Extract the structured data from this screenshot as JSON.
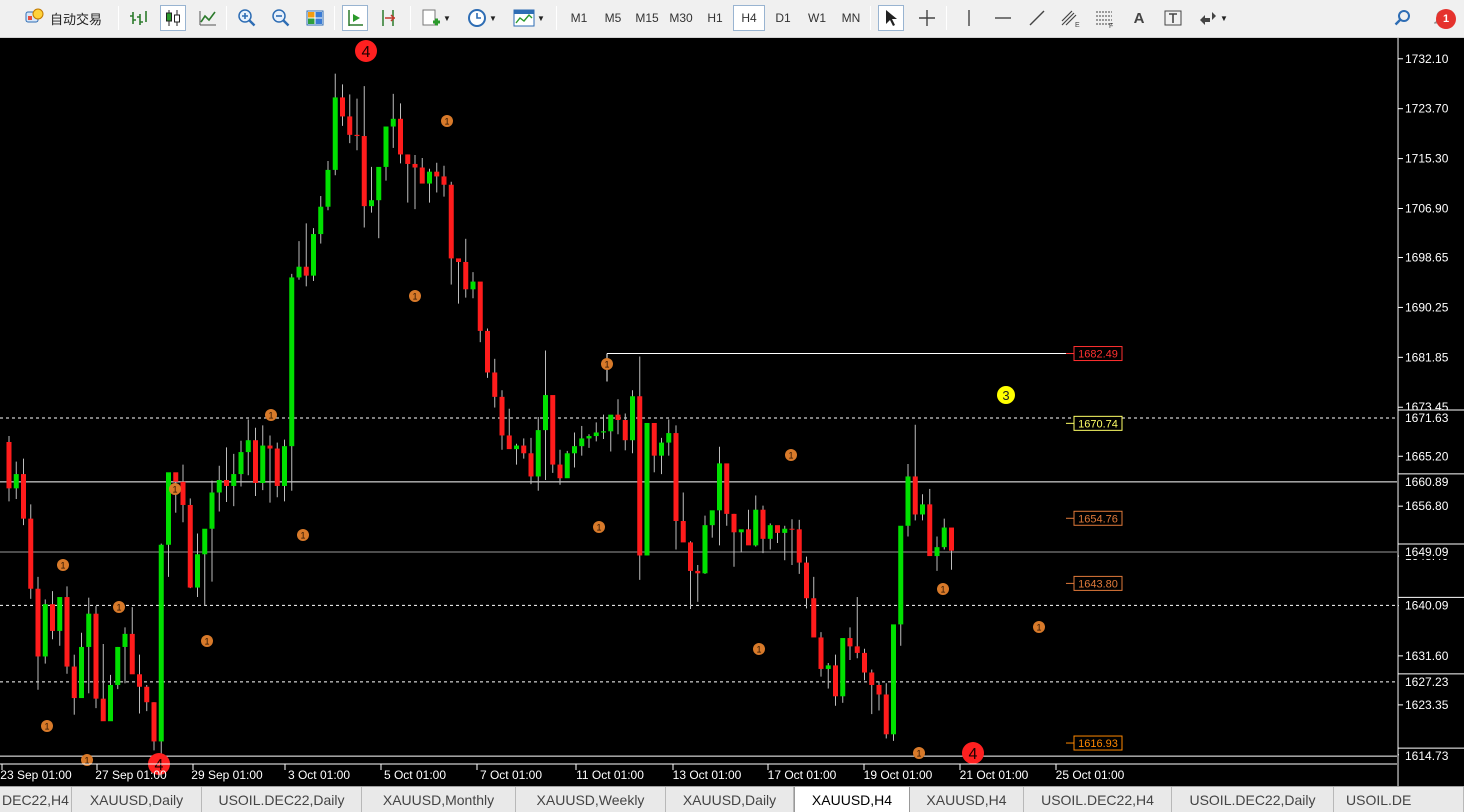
{
  "toolbar": {
    "autotrade_label": "自动交易",
    "timeframes": [
      "M1",
      "M5",
      "M15",
      "M30",
      "H1",
      "H4",
      "D1",
      "W1",
      "MN"
    ],
    "active_timeframe": "H4",
    "notifications_count": "1",
    "text_tool_label": "A",
    "equidistant_suffix": "E",
    "fib_suffix": "F",
    "icons": [
      "autotrade-icon",
      "bar-chart-icon",
      "candlestick-icon",
      "line-chart-icon",
      "zoom-in-icon",
      "zoom-out-icon",
      "tile-windows-icon",
      "auto-scroll-icon",
      "chart-shift-icon",
      "new-order-icon",
      "periods-icon",
      "templates-icon",
      "cursor-icon",
      "crosshair-icon",
      "vertical-line-icon",
      "horizontal-line-icon",
      "trendline-icon",
      "equidistant-channel-icon",
      "fibonacci-icon",
      "text-icon",
      "text-label-icon",
      "arrows-icon",
      "search-icon",
      "notifications-icon"
    ]
  },
  "chart": {
    "symbol": "XAUUSD",
    "timeframe": "H4",
    "colors": {
      "background": "#000000",
      "bull": "#00e000",
      "bear": "#ff1c1c",
      "wick": "#bdbdbd",
      "grid_line": "#ffffff",
      "wave_minor": "#d87a2a",
      "wave_major": "#ff2020",
      "wave_3": "#ffff00"
    },
    "price_axis": [
      "1732.10",
      "1723.70",
      "1715.30",
      "1706.90",
      "1698.65",
      "1690.25",
      "1681.85",
      "1673.45",
      "1665.20",
      "1656.80",
      "1648.40",
      "1640.05",
      "1631.60",
      "1623.35",
      "1614.95"
    ],
    "price_axis_highlights": [
      {
        "value": "1671.63",
        "style": "dashed"
      },
      {
        "value": "1660.89",
        "style": "solid"
      },
      {
        "value": "1649.09",
        "style": "solid-gray"
      },
      {
        "value": "1640.09",
        "style": "dashed"
      },
      {
        "value": "1627.23",
        "style": "dashed"
      },
      {
        "value": "1614.73",
        "style": "solid"
      }
    ],
    "time_axis": [
      "23 Sep 01:00",
      "27 Sep 01:00",
      "29 Sep 01:00",
      "3 Oct 01:00",
      "5 Oct 01:00",
      "7 Oct 01:00",
      "11 Oct 01:00",
      "13 Oct 01:00",
      "17 Oct 01:00",
      "19 Oct 01:00",
      "21 Oct 01:00",
      "25 Oct 01:00"
    ],
    "level_labels": [
      {
        "value": "1682.49",
        "color": "#ff3030",
        "border": "#ff3030"
      },
      {
        "value": "1670.74",
        "color": "#ffff66",
        "border": "#ffff66"
      },
      {
        "value": "1654.76",
        "color": "#e07a3a",
        "border": "#e07a3a"
      },
      {
        "value": "1643.80",
        "color": "#e07a3a",
        "border": "#e07a3a"
      },
      {
        "value": "1616.93",
        "color": "#ff8800",
        "border": "#ff8800"
      }
    ],
    "wave_markers": [
      {
        "label": "4",
        "kind": "major"
      },
      {
        "label": "1",
        "kind": "minor"
      },
      {
        "label": "3",
        "kind": "wave3"
      }
    ]
  },
  "chart_data": {
    "type": "candlestick",
    "title": "",
    "xlabel": "",
    "ylabel": "",
    "ylim": [
      1613.4,
      1735.6
    ],
    "x_ticks": [
      "23 Sep 01:00",
      "27 Sep 01:00",
      "29 Sep 01:00",
      "3 Oct 01:00",
      "5 Oct 01:00",
      "7 Oct 01:00",
      "11 Oct 01:00",
      "13 Oct 01:00",
      "17 Oct 01:00",
      "19 Oct 01:00",
      "21 Oct 01:00",
      "25 Oct 01:00"
    ],
    "ohlc": [
      [
        1667.6,
        1668.6,
        1657.6,
        1659.8
      ],
      [
        1659.8,
        1664.3,
        1658.0,
        1662.2
      ],
      [
        1662.2,
        1664.8,
        1653.6,
        1654.7
      ],
      [
        1654.7,
        1657.1,
        1641.2,
        1642.9
      ],
      [
        1642.9,
        1644.9,
        1625.9,
        1631.5
      ],
      [
        1631.5,
        1641.1,
        1630.3,
        1640.3
      ],
      [
        1640.3,
        1642.5,
        1634.4,
        1635.8
      ],
      [
        1635.8,
        1640.2,
        1633.3,
        1641.5
      ],
      [
        1641.5,
        1643.3,
        1628.6,
        1629.8
      ],
      [
        1629.8,
        1631.8,
        1621.7,
        1624.5
      ],
      [
        1624.5,
        1635.5,
        1625.9,
        1633.1
      ],
      [
        1633.1,
        1641.4,
        1625.3,
        1638.7
      ],
      [
        1638.7,
        1640.0,
        1622.8,
        1624.4
      ],
      [
        1624.4,
        1633.6,
        1621.6,
        1620.6
      ],
      [
        1620.6,
        1628.4,
        1622.0,
        1626.7
      ],
      [
        1626.7,
        1633.1,
        1626.0,
        1633.1
      ],
      [
        1633.1,
        1636.4,
        1627.0,
        1635.3
      ],
      [
        1635.3,
        1639.8,
        1628.9,
        1628.5
      ],
      [
        1628.5,
        1631.8,
        1621.9,
        1626.4
      ],
      [
        1626.4,
        1626.7,
        1622.3,
        1623.8
      ],
      [
        1623.8,
        1623.8,
        1615.7,
        1617.2
      ],
      [
        1617.2,
        1650.5,
        1614.5,
        1650.3
      ],
      [
        1650.3,
        1659.2,
        1644.9,
        1662.5
      ],
      [
        1662.5,
        1660.9,
        1655.7,
        1660.9
      ],
      [
        1660.9,
        1663.8,
        1654.1,
        1657.0
      ],
      [
        1657.0,
        1658.1,
        1643.0,
        1643.1
      ],
      [
        1643.1,
        1652.2,
        1641.5,
        1648.7
      ],
      [
        1648.7,
        1651.5,
        1640.1,
        1653.0
      ],
      [
        1653.0,
        1661.1,
        1644.1,
        1659.1
      ],
      [
        1659.1,
        1663.6,
        1655.9,
        1661.2
      ],
      [
        1661.2,
        1666.7,
        1657.5,
        1660.2
      ],
      [
        1660.2,
        1665.6,
        1656.8,
        1662.2
      ],
      [
        1662.2,
        1667.8,
        1660.1,
        1665.9
      ],
      [
        1665.9,
        1671.4,
        1662.0,
        1667.9
      ],
      [
        1667.9,
        1670.0,
        1658.5,
        1660.7
      ],
      [
        1660.7,
        1670.4,
        1659.5,
        1667.0
      ],
      [
        1667.0,
        1668.7,
        1657.4,
        1666.5
      ],
      [
        1666.5,
        1667.5,
        1658.3,
        1660.2
      ],
      [
        1660.2,
        1668.0,
        1657.6,
        1666.9
      ],
      [
        1666.9,
        1695.9,
        1659.4,
        1695.3
      ],
      [
        1695.3,
        1701.4,
        1694.9,
        1697.1
      ],
      [
        1697.1,
        1704.4,
        1693.8,
        1695.6
      ],
      [
        1695.6,
        1703.6,
        1694.7,
        1702.6
      ],
      [
        1702.6,
        1709.0,
        1701.0,
        1707.2
      ],
      [
        1707.2,
        1714.9,
        1706.6,
        1713.4
      ],
      [
        1713.4,
        1729.6,
        1712.5,
        1725.6
      ],
      [
        1725.6,
        1727.8,
        1720.8,
        1722.4
      ],
      [
        1722.4,
        1726.1,
        1717.9,
        1719.3
      ],
      [
        1719.3,
        1725.4,
        1716.7,
        1719.1
      ],
      [
        1719.1,
        1727.5,
        1703.7,
        1707.3
      ],
      [
        1707.3,
        1713.9,
        1706.2,
        1708.3
      ],
      [
        1708.3,
        1711.9,
        1701.9,
        1713.9
      ],
      [
        1713.9,
        1718.4,
        1711.6,
        1720.7
      ],
      [
        1720.7,
        1726.2,
        1717.1,
        1722.0
      ],
      [
        1722.0,
        1724.6,
        1714.5,
        1716.0
      ],
      [
        1716.0,
        1716.0,
        1707.9,
        1714.4
      ],
      [
        1714.4,
        1715.9,
        1706.8,
        1713.8
      ],
      [
        1713.8,
        1715.4,
        1711.9,
        1711.1
      ],
      [
        1711.1,
        1713.6,
        1707.9,
        1713.1
      ],
      [
        1713.1,
        1714.6,
        1709.6,
        1712.3
      ],
      [
        1712.3,
        1714.1,
        1708.9,
        1710.9
      ],
      [
        1710.9,
        1711.4,
        1694.1,
        1698.5
      ],
      [
        1698.5,
        1698.4,
        1690.9,
        1697.9
      ],
      [
        1697.9,
        1701.8,
        1691.9,
        1693.3
      ],
      [
        1693.3,
        1696.2,
        1691.8,
        1694.6
      ],
      [
        1694.6,
        1694.1,
        1684.4,
        1686.3
      ],
      [
        1686.3,
        1686.7,
        1678.4,
        1679.3
      ],
      [
        1679.3,
        1681.6,
        1673.4,
        1675.2
      ],
      [
        1675.2,
        1676.3,
        1666.3,
        1668.7
      ],
      [
        1668.7,
        1673.2,
        1667.1,
        1666.4
      ],
      [
        1666.4,
        1667.3,
        1663.8,
        1667.0
      ],
      [
        1667.0,
        1668.2,
        1664.8,
        1665.7
      ],
      [
        1665.7,
        1668.3,
        1660.5,
        1661.8
      ],
      [
        1661.8,
        1671.8,
        1659.4,
        1669.6
      ],
      [
        1669.6,
        1683.0,
        1661.2,
        1675.5
      ],
      [
        1675.5,
        1673.4,
        1662.4,
        1663.8
      ],
      [
        1663.8,
        1666.3,
        1660.4,
        1661.5
      ],
      [
        1661.5,
        1666.1,
        1663.6,
        1665.7
      ],
      [
        1665.7,
        1669.2,
        1663.3,
        1666.9
      ],
      [
        1666.9,
        1670.3,
        1665.3,
        1668.2
      ],
      [
        1668.2,
        1668.9,
        1666.6,
        1668.6
      ],
      [
        1668.6,
        1670.9,
        1667.7,
        1669.2
      ],
      [
        1669.2,
        1672.2,
        1668.1,
        1669.4
      ],
      [
        1669.4,
        1671.8,
        1666.0,
        1672.2
      ],
      [
        1672.2,
        1674.8,
        1668.9,
        1671.3
      ],
      [
        1671.3,
        1672.4,
        1666.2,
        1667.9
      ],
      [
        1667.9,
        1676.3,
        1665.7,
        1675.3
      ],
      [
        1675.3,
        1682.0,
        1644.4,
        1648.5
      ],
      [
        1648.5,
        1669.1,
        1648.5,
        1670.8
      ],
      [
        1670.8,
        1670.3,
        1662.5,
        1665.3
      ],
      [
        1665.3,
        1668.3,
        1662.2,
        1667.5
      ],
      [
        1667.5,
        1671.4,
        1665.3,
        1669.1
      ],
      [
        1669.1,
        1670.4,
        1649.5,
        1654.3
      ],
      [
        1654.3,
        1659.1,
        1651.2,
        1650.7
      ],
      [
        1650.7,
        1650.9,
        1639.5,
        1645.9
      ],
      [
        1645.9,
        1646.9,
        1640.7,
        1645.5
      ],
      [
        1645.5,
        1655.2,
        1645.4,
        1653.6
      ],
      [
        1653.6,
        1655.3,
        1651.5,
        1656.1
      ],
      [
        1656.1,
        1666.8,
        1650.2,
        1664.0
      ],
      [
        1664.0,
        1663.8,
        1653.5,
        1655.5
      ],
      [
        1655.5,
        1655.5,
        1646.6,
        1652.4
      ],
      [
        1652.4,
        1652.8,
        1649.0,
        1652.9
      ],
      [
        1652.9,
        1656.2,
        1650.3,
        1650.2
      ],
      [
        1650.2,
        1658.6,
        1650.0,
        1656.2
      ],
      [
        1656.2,
        1656.9,
        1648.9,
        1651.3
      ],
      [
        1651.3,
        1653.9,
        1649.5,
        1653.6
      ],
      [
        1653.6,
        1653.4,
        1650.6,
        1652.3
      ],
      [
        1652.3,
        1653.5,
        1647.7,
        1653.0
      ],
      [
        1653.0,
        1654.6,
        1646.9,
        1652.9
      ],
      [
        1652.9,
        1654.5,
        1645.4,
        1647.3
      ],
      [
        1647.3,
        1648.3,
        1639.6,
        1641.3
      ],
      [
        1641.3,
        1644.9,
        1636.9,
        1634.7
      ],
      [
        1634.7,
        1635.6,
        1628.1,
        1629.4
      ],
      [
        1629.4,
        1630.4,
        1626.1,
        1630.0
      ],
      [
        1630.0,
        1631.8,
        1623.2,
        1624.8
      ],
      [
        1624.8,
        1632.7,
        1623.7,
        1634.6
      ],
      [
        1634.6,
        1636.4,
        1630.9,
        1633.2
      ],
      [
        1633.2,
        1641.5,
        1631.2,
        1632.1
      ],
      [
        1632.1,
        1632.8,
        1627.5,
        1628.8
      ],
      [
        1628.8,
        1629.3,
        1621.8,
        1626.7
      ],
      [
        1626.7,
        1627.3,
        1622.4,
        1625.1
      ],
      [
        1625.1,
        1627.0,
        1617.7,
        1618.4
      ],
      [
        1618.4,
        1627.0,
        1617.3,
        1636.9
      ],
      [
        1636.9,
        1652.7,
        1633.3,
        1653.5
      ],
      [
        1653.5,
        1663.9,
        1651.7,
        1661.8
      ],
      [
        1661.8,
        1670.5,
        1654.4,
        1655.4
      ],
      [
        1655.4,
        1658.8,
        1654.4,
        1657.1
      ],
      [
        1657.1,
        1659.7,
        1648.8,
        1648.4
      ],
      [
        1648.4,
        1651.7,
        1645.9,
        1649.9
      ],
      [
        1649.9,
        1654.7,
        1649.5,
        1653.2
      ],
      [
        1653.2,
        1650.6,
        1646.1,
        1649.3
      ]
    ]
  },
  "tabs": [
    "DEC22,H4",
    "XAUUSD,Daily",
    "USOIL.DEC22,Daily",
    "XAUUSD,Monthly",
    "XAUUSD,Weekly",
    "XAUUSD,Daily",
    "XAUUSD,H4",
    "XAUUSD,H4",
    "USOIL.DEC22,H4",
    "USOIL.DEC22,Daily",
    "USOIL.DE"
  ],
  "active_tab_index": 6
}
